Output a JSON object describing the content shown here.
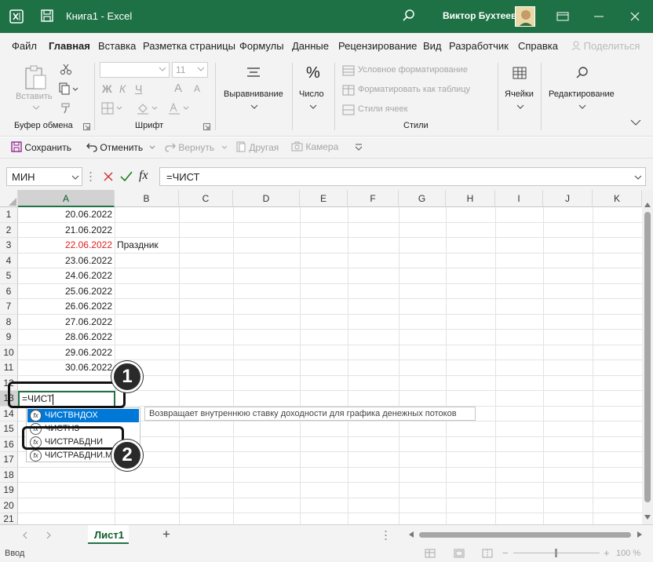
{
  "titlebar": {
    "doc_title": "Книга1  -  Excel",
    "user_name": "Виктор Бухтеев"
  },
  "menu": {
    "tabs": [
      "Файл",
      "Главная",
      "Вставка",
      "Разметка страницы",
      "Формулы",
      "Данные",
      "Рецензирование",
      "Вид",
      "Разработчик",
      "Справка"
    ],
    "share": "Поделиться"
  },
  "ribbon": {
    "clipboard": {
      "paste": "Вставить",
      "label": "Буфер обмена"
    },
    "font": {
      "size": "11",
      "bold": "Ж",
      "italic": "К",
      "underline": "Ч",
      "grow": "A",
      "shrink": "A",
      "label": "Шрифт"
    },
    "alignment": {
      "label": "Выравнивание"
    },
    "number": {
      "label": "Число",
      "symbol": "%"
    },
    "styles": {
      "conditional": "Условное форматирование",
      "as_table": "Форматировать как таблицу",
      "cell_styles": "Стили ячеек",
      "label": "Стили"
    },
    "cells": {
      "label": "Ячейки"
    },
    "editing": {
      "label": "Редактирование"
    }
  },
  "qat": {
    "save": "Сохранить",
    "undo": "Отменить",
    "redo": "Вернуть",
    "other": "Другая",
    "camera": "Камера"
  },
  "formula_bar": {
    "name_box": "МИН",
    "formula": "=ЧИСТ",
    "fx": "fx"
  },
  "grid": {
    "columns": [
      "A",
      "B",
      "C",
      "D",
      "E",
      "F",
      "G",
      "H",
      "I",
      "J",
      "K"
    ],
    "rows": [
      "1",
      "2",
      "3",
      "4",
      "5",
      "6",
      "7",
      "8",
      "9",
      "10",
      "11",
      "12",
      "13",
      "14",
      "15",
      "16",
      "17",
      "18",
      "19",
      "20",
      "21"
    ],
    "dates": [
      "20.06.2022",
      "21.06.2022",
      "22.06.2022",
      "23.06.2022",
      "24.06.2022",
      "25.06.2022",
      "26.06.2022",
      "27.06.2022",
      "28.06.2022",
      "29.06.2022",
      "30.06.2022"
    ],
    "b3": "Праздник",
    "holiday_color": "#e02020",
    "editing_value": "=ЧИСТ"
  },
  "autocomplete": {
    "items": [
      "ЧИСТВНДОХ",
      "ЧИСТНЗ",
      "ЧИСТРАБДНИ",
      "ЧИСТРАБДНИ.МЕЖД"
    ],
    "tooltip": "Возвращает внутреннюю ставку доходности для графика денежных потоков"
  },
  "callouts": [
    "1",
    "2"
  ],
  "sheets": {
    "active": "Лист1",
    "add": "+"
  },
  "status": {
    "mode": "Ввод",
    "zoom": "100 %"
  },
  "colors": {
    "excel_green": "#1e7145",
    "selection_blue": "#0078d7",
    "grid_line": "#e3e3e3"
  }
}
